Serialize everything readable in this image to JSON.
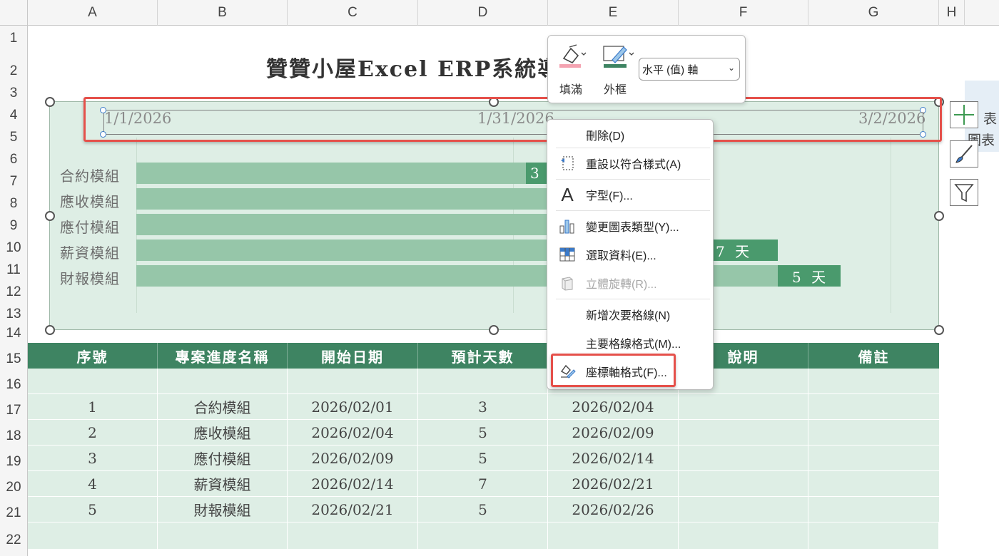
{
  "columns": [
    "A",
    "B",
    "C",
    "D",
    "E",
    "F",
    "G",
    "H"
  ],
  "rows": [
    "1",
    "2",
    "3",
    "4",
    "5",
    "6",
    "7",
    "8",
    "9",
    "10",
    "11",
    "12",
    "13",
    "14",
    "15",
    "16",
    "17",
    "18",
    "19",
    "20",
    "21",
    "22"
  ],
  "sheet_title": "贊贊小屋Excel ERP系統導",
  "chart": {
    "axis_ticks": [
      "1/1/2026",
      "1/31/2026",
      "3/2/2026"
    ],
    "categories": [
      "合約模組",
      "應收模組",
      "應付模組",
      "薪資模組",
      "財報模組"
    ],
    "segment_labels": [
      "3",
      "7 天",
      "5 天"
    ]
  },
  "chart_data": {
    "type": "bar",
    "orientation": "horizontal",
    "categories": [
      "合約模組",
      "應收模組",
      "應付模組",
      "薪資模組",
      "財報模組"
    ],
    "x_ticks": [
      "1/1/2026",
      "1/31/2026",
      "3/2/2026"
    ],
    "series": [
      {
        "values": [
          "2026/02/01",
          "2026/02/04",
          "2026/02/09",
          "2026/02/14",
          "2026/02/21"
        ]
      },
      {
        "values": [
          3,
          5,
          5,
          7,
          5
        ]
      }
    ],
    "data_labels": [
      "3",
      "7 天",
      "5 天"
    ]
  },
  "mini_toolbar": {
    "fill_label": "填滿",
    "border_label": "外框",
    "select_value": "水平 (值) 軸",
    "fill_color": "#f4a3b1",
    "border_color": "#3e8462"
  },
  "context_menu": [
    {
      "label": "刪除(D)",
      "icon": "none"
    },
    {
      "label": "重設以符合樣式(A)",
      "icon": "reset-style-icon"
    },
    {
      "label": "字型(F)...",
      "icon": "font-icon"
    },
    {
      "label": "變更圖表類型(Y)...",
      "icon": "change-chart-type-icon"
    },
    {
      "label": "選取資料(E)...",
      "icon": "select-data-icon"
    },
    {
      "label": "立體旋轉(R)...",
      "icon": "3d-rotation-icon",
      "disabled": true
    },
    {
      "label": "新增次要格線(N)",
      "icon": "none"
    },
    {
      "label": "主要格線格式(M)...",
      "icon": "none"
    },
    {
      "label": "座標軸格式(F)...",
      "icon": "format-axis-icon"
    }
  ],
  "side_panel_text": [
    "表",
    "圖表"
  ],
  "table": {
    "headers": [
      "序號",
      "專案進度名稱",
      "開始日期",
      "預計天數",
      "",
      "說明",
      "備註"
    ],
    "rows": [
      [
        "",
        "",
        "",
        "",
        "",
        "",
        ""
      ],
      [
        "1",
        "合約模組",
        "2026/02/01",
        "3",
        "2026/02/04",
        "",
        ""
      ],
      [
        "2",
        "應收模組",
        "2026/02/04",
        "5",
        "2026/02/09",
        "",
        ""
      ],
      [
        "3",
        "應付模組",
        "2026/02/09",
        "5",
        "2026/02/14",
        "",
        ""
      ],
      [
        "4",
        "薪資模組",
        "2026/02/14",
        "7",
        "2026/02/21",
        "",
        ""
      ],
      [
        "5",
        "財報模組",
        "2026/02/21",
        "5",
        "2026/02/26",
        "",
        ""
      ]
    ]
  },
  "colors": {
    "header_green": "#3e8462",
    "band_green": "#deeee5",
    "highlight_red": "#e5504a"
  }
}
